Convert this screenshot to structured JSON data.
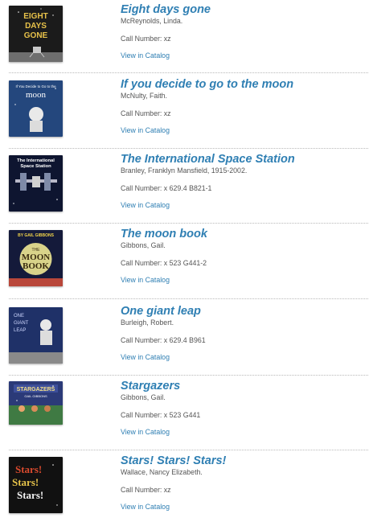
{
  "catalog_link_label": "View in Catalog",
  "books": [
    {
      "title": "Eight days gone",
      "author": "McReynolds, Linda.",
      "call_number": "Call Number: xz",
      "cover_text": [
        "EIGHT",
        "DAYS",
        "GONE"
      ]
    },
    {
      "title": "If you decide to go to the moon",
      "author": "McNulty, Faith.",
      "call_number": "Call Number: xz",
      "cover_text": [
        "If You Decide to Go to the",
        "moon"
      ]
    },
    {
      "title": "The International Space Station",
      "author": "Branley, Franklyn Mansfield, 1915-2002.",
      "call_number": "Call Number: x 629.4 B821-1",
      "cover_text": [
        "The International",
        "Space Station"
      ]
    },
    {
      "title": "The moon book",
      "author": "Gibbons, Gail.",
      "call_number": "Call Number: x 523 G441-2",
      "cover_text": [
        "BY GAIL GIBBONS",
        "THE",
        "MOON",
        "BOOK"
      ]
    },
    {
      "title": "One giant leap",
      "author": "Burleigh, Robert.",
      "call_number": "Call Number: x 629.4 B961",
      "cover_text": [
        "ONE",
        "GIANT",
        "LEAP"
      ]
    },
    {
      "title": "Stargazers",
      "author": "Gibbons, Gail.",
      "call_number": "Call Number: x 523 G441",
      "cover_text": [
        "STARGAZERS",
        "GAIL GIBBONS"
      ]
    },
    {
      "title": "Stars! Stars! Stars!",
      "author": "Wallace, Nancy Elizabeth.",
      "call_number": "Call Number: xz",
      "cover_text": [
        "Stars!",
        "Stars!",
        "Stars!"
      ]
    }
  ]
}
